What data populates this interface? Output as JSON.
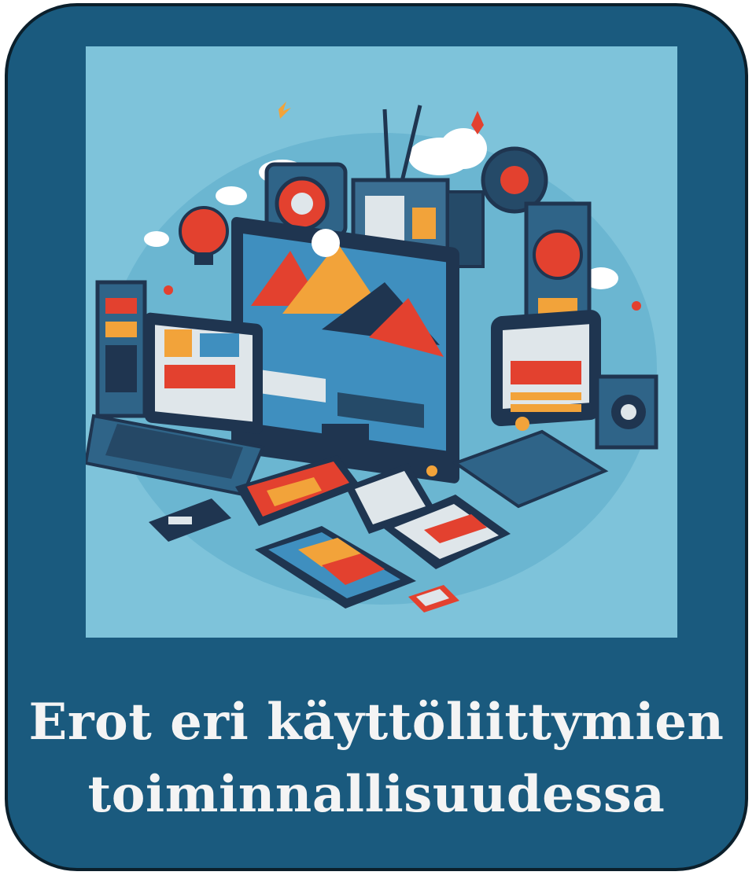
{
  "card": {
    "title_line_1": "Erot eri käyttöliittymien",
    "title_line_2": "toiminnallisuudessa"
  },
  "colors": {
    "frame": "#1a5a7e",
    "border": "#0b1f2b",
    "illustration_bg": "#7ec3da",
    "caption_text": "#f4f4f4",
    "accent_red": "#e3412f",
    "accent_orange": "#f2a33a",
    "navy": "#1f3550"
  }
}
